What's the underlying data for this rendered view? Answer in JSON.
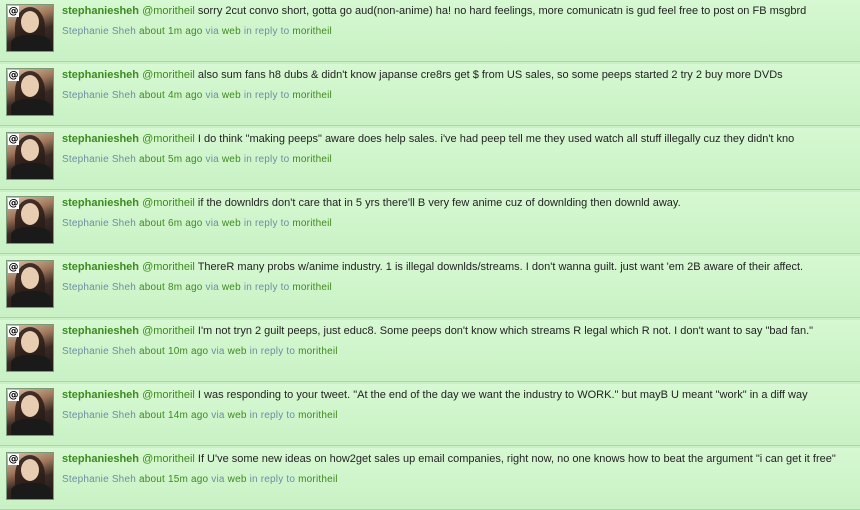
{
  "tweets": [
    {
      "screen_name": "stephaniesheh",
      "mention": "@moritheil",
      "text": "sorry 2cut convo short, gotta go aud(non-anime) ha! no hard feelings, more comunicatn is gud feel free to post on FB msgbrd",
      "real_name": "Stephanie Sheh",
      "time": "about 1m ago",
      "via": "via",
      "source": "web",
      "reply_prefix": "in reply to",
      "reply_to": "moritheil"
    },
    {
      "screen_name": "stephaniesheh",
      "mention": "@moritheil",
      "text": "also sum fans h8 dubs & didn't know japanse cre8rs get $ from US sales, so some peeps started 2 try 2 buy more DVDs",
      "real_name": "Stephanie Sheh",
      "time": "about 4m ago",
      "via": "via",
      "source": "web",
      "reply_prefix": "in reply to",
      "reply_to": "moritheil"
    },
    {
      "screen_name": "stephaniesheh",
      "mention": "@moritheil",
      "text": "I do think \"making peeps\" aware does help sales. i've had peep tell me they used watch all stuff illegally cuz they didn't kno",
      "real_name": "Stephanie Sheh",
      "time": "about 5m ago",
      "via": "via",
      "source": "web",
      "reply_prefix": "in reply to",
      "reply_to": "moritheil"
    },
    {
      "screen_name": "stephaniesheh",
      "mention": "@moritheil",
      "text": "if the downldrs don't care that in 5 yrs there'll B very few anime cuz of downlding then downld away.",
      "real_name": "Stephanie Sheh",
      "time": "about 6m ago",
      "via": "via",
      "source": "web",
      "reply_prefix": "in reply to",
      "reply_to": "moritheil"
    },
    {
      "screen_name": "stephaniesheh",
      "mention": "@moritheil",
      "text": "ThereR many probs w/anime industry. 1 is illegal downlds/streams. I don't wanna guilt. just want 'em 2B aware of their affect.",
      "real_name": "Stephanie Sheh",
      "time": "about 8m ago",
      "via": "via",
      "source": "web",
      "reply_prefix": "in reply to",
      "reply_to": "moritheil"
    },
    {
      "screen_name": "stephaniesheh",
      "mention": "@moritheil",
      "text": "I'm not tryn 2 guilt peeps, just educ8. Some peeps don't know which streams R legal which R not. I don't want to say \"bad fan.\"",
      "real_name": "Stephanie Sheh",
      "time": "about 10m ago",
      "via": "via",
      "source": "web",
      "reply_prefix": "in reply to",
      "reply_to": "moritheil"
    },
    {
      "screen_name": "stephaniesheh",
      "mention": "@moritheil",
      "text": "I was responding to your tweet. \"At the end of the day we want the industry to WORK.\" but mayB U meant \"work\" in a diff way",
      "real_name": "Stephanie Sheh",
      "time": "about 14m ago",
      "via": "via",
      "source": "web",
      "reply_prefix": "in reply to",
      "reply_to": "moritheil"
    },
    {
      "screen_name": "stephaniesheh",
      "mention": "@moritheil",
      "text": "If U've some new ideas on how2get sales up email companies, right now, no one knows how to beat the argument \"i can get it free\"",
      "real_name": "Stephanie Sheh",
      "time": "about 15m ago",
      "via": "via",
      "source": "web",
      "reply_prefix": "in reply to",
      "reply_to": "moritheil"
    }
  ],
  "avatar_badge": "@",
  "colors": {
    "background": "#c8f0c4",
    "link_green": "#3d8a1f",
    "meta_blue": "#6a8fa3"
  }
}
